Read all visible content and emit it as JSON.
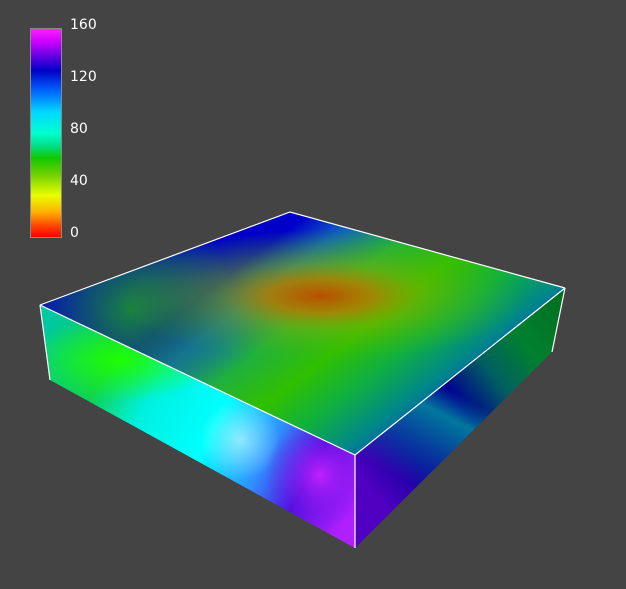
{
  "colorbar": {
    "ticks": [
      "160",
      "120",
      "80",
      "40",
      "0"
    ],
    "tick_values": [
      160,
      120,
      80,
      40,
      0
    ],
    "min": 0,
    "max": 160,
    "colormap": [
      "#ff20ff",
      "#0000c8",
      "#00d8ff",
      "#10c800",
      "#e8ff00",
      "#ff0000"
    ]
  },
  "scene": {
    "background": "#444444",
    "edge_color": "#ffffff"
  }
}
